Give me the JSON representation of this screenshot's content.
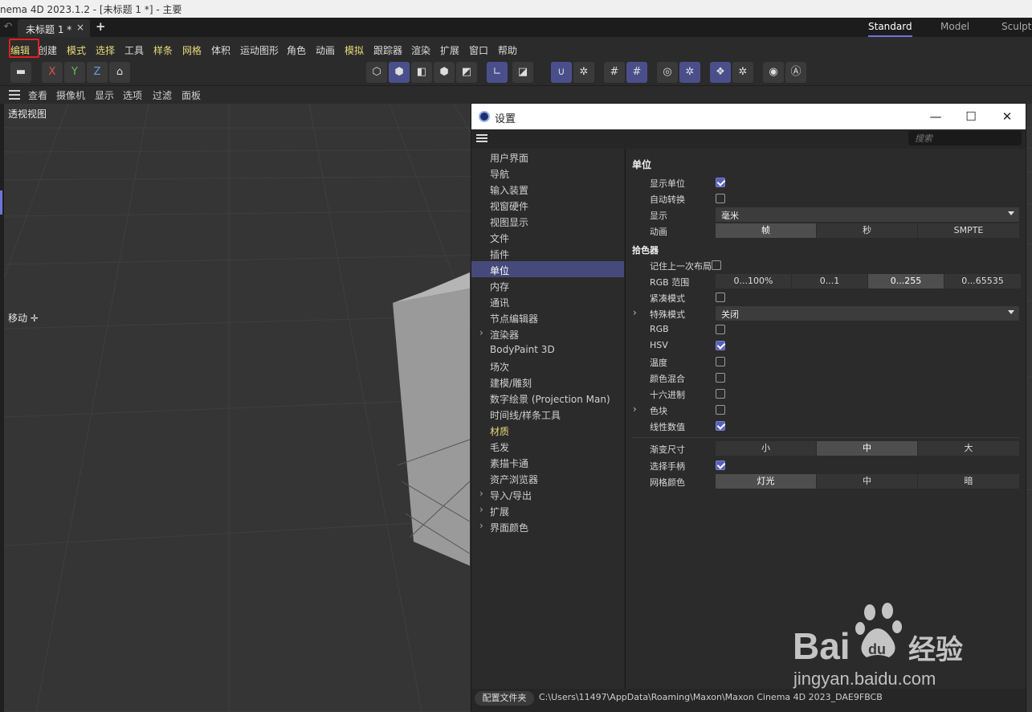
{
  "window": {
    "title": "nema 4D 2023.1.2 - [未标题 1 *] - 主要"
  },
  "tabs": {
    "document_tab": "未标题 1 *",
    "close": "×",
    "add": "+",
    "layouts": [
      "Standard",
      "Model",
      "Sculpt"
    ],
    "active_layout": "Standard"
  },
  "menu": [
    "编辑",
    "创建",
    "模式",
    "选择",
    "工具",
    "样条",
    "网格",
    "体积",
    "运动图形",
    "角色",
    "动画",
    "模拟",
    "跟踪器",
    "渲染",
    "扩展",
    "窗口",
    "帮助"
  ],
  "toolbar": {
    "axis": [
      "X",
      "Y",
      "Z"
    ]
  },
  "viewport_menu": [
    "查看",
    "摄像机",
    "显示",
    "选项",
    "过滤",
    "面板"
  ],
  "viewport": {
    "name": "透视视图",
    "tool_label": "移动"
  },
  "dialog": {
    "title": "设置",
    "search_placeholder": "搜索",
    "nav": [
      {
        "label": "用户界面",
        "chevron": ""
      },
      {
        "label": "导航",
        "chevron": ""
      },
      {
        "label": "输入装置",
        "chevron": ""
      },
      {
        "label": "视窗硬件",
        "chevron": ""
      },
      {
        "label": "视图显示",
        "chevron": ""
      },
      {
        "label": "文件",
        "chevron": ""
      },
      {
        "label": "插件",
        "chevron": ""
      },
      {
        "label": "单位",
        "chevron": ""
      },
      {
        "label": "内存",
        "chevron": ""
      },
      {
        "label": "通讯",
        "chevron": ""
      },
      {
        "label": "节点编辑器",
        "chevron": ""
      },
      {
        "label": "渲染器",
        "chevron": "›"
      },
      {
        "label": "BodyPaint 3D",
        "chevron": ""
      },
      {
        "label": "场次",
        "chevron": ""
      },
      {
        "label": "建模/雕刻",
        "chevron": ""
      },
      {
        "label": "数字绘景 (Projection Man)",
        "chevron": ""
      },
      {
        "label": "时间线/样条工具",
        "chevron": ""
      },
      {
        "label": "材质",
        "chevron": ""
      },
      {
        "label": "毛发",
        "chevron": ""
      },
      {
        "label": "素描卡通",
        "chevron": ""
      },
      {
        "label": "资产浏览器",
        "chevron": ""
      },
      {
        "label": "导入/导出",
        "chevron": "›"
      },
      {
        "label": "扩展",
        "chevron": "›"
      },
      {
        "label": "界面颜色",
        "chevron": "›"
      }
    ],
    "active_nav": "单位",
    "section_title": "单位",
    "units": {
      "show_units": {
        "label": "显示单位",
        "checked": true
      },
      "auto_convert": {
        "label": "自动转换",
        "checked": false
      },
      "display": {
        "label": "显示",
        "value": "毫米"
      },
      "animation": {
        "label": "动画",
        "options": [
          "帧",
          "秒",
          "SMPTE"
        ],
        "selected": "帧"
      }
    },
    "picker_title": "拾色器",
    "picker": {
      "remember_layout": {
        "label": "记住上一次布局",
        "checked": false
      },
      "rgb_range": {
        "label": "RGB 范围",
        "options": [
          "0...100%",
          "0...1",
          "0...255",
          "0...65535"
        ],
        "selected": "0...255"
      },
      "compact_mode": {
        "label": "紧凑模式",
        "checked": false
      },
      "special_mode": {
        "label": "特殊模式",
        "value": "关闭",
        "chevron": "›"
      },
      "rgb": {
        "label": "RGB",
        "checked": false
      },
      "hsv": {
        "label": "HSV",
        "checked": true
      },
      "temperature": {
        "label": "温度",
        "checked": false
      },
      "color_mix": {
        "label": "颜色混合",
        "checked": false
      },
      "hex": {
        "label": "十六进制",
        "checked": false
      },
      "swatches": {
        "label": "色块",
        "checked": false,
        "chevron": "›"
      },
      "linear": {
        "label": "线性数值",
        "checked": true
      }
    },
    "misc": {
      "gradient_size": {
        "label": "渐变尺寸",
        "options": [
          "小",
          "中",
          "大"
        ],
        "selected": "中"
      },
      "select_handle": {
        "label": "选择手柄",
        "checked": true
      },
      "grid_color": {
        "label": "网格颜色",
        "options": [
          "灯光",
          "中",
          "暗"
        ],
        "selected": "灯光"
      }
    },
    "status": {
      "button": "配置文件夹",
      "path": "C:\\Users\\11497\\AppData\\Roaming\\Maxon\\Maxon Cinema 4D 2023_DAE9FBCB"
    }
  },
  "watermark": {
    "url": "jingyan.baidu.com"
  }
}
